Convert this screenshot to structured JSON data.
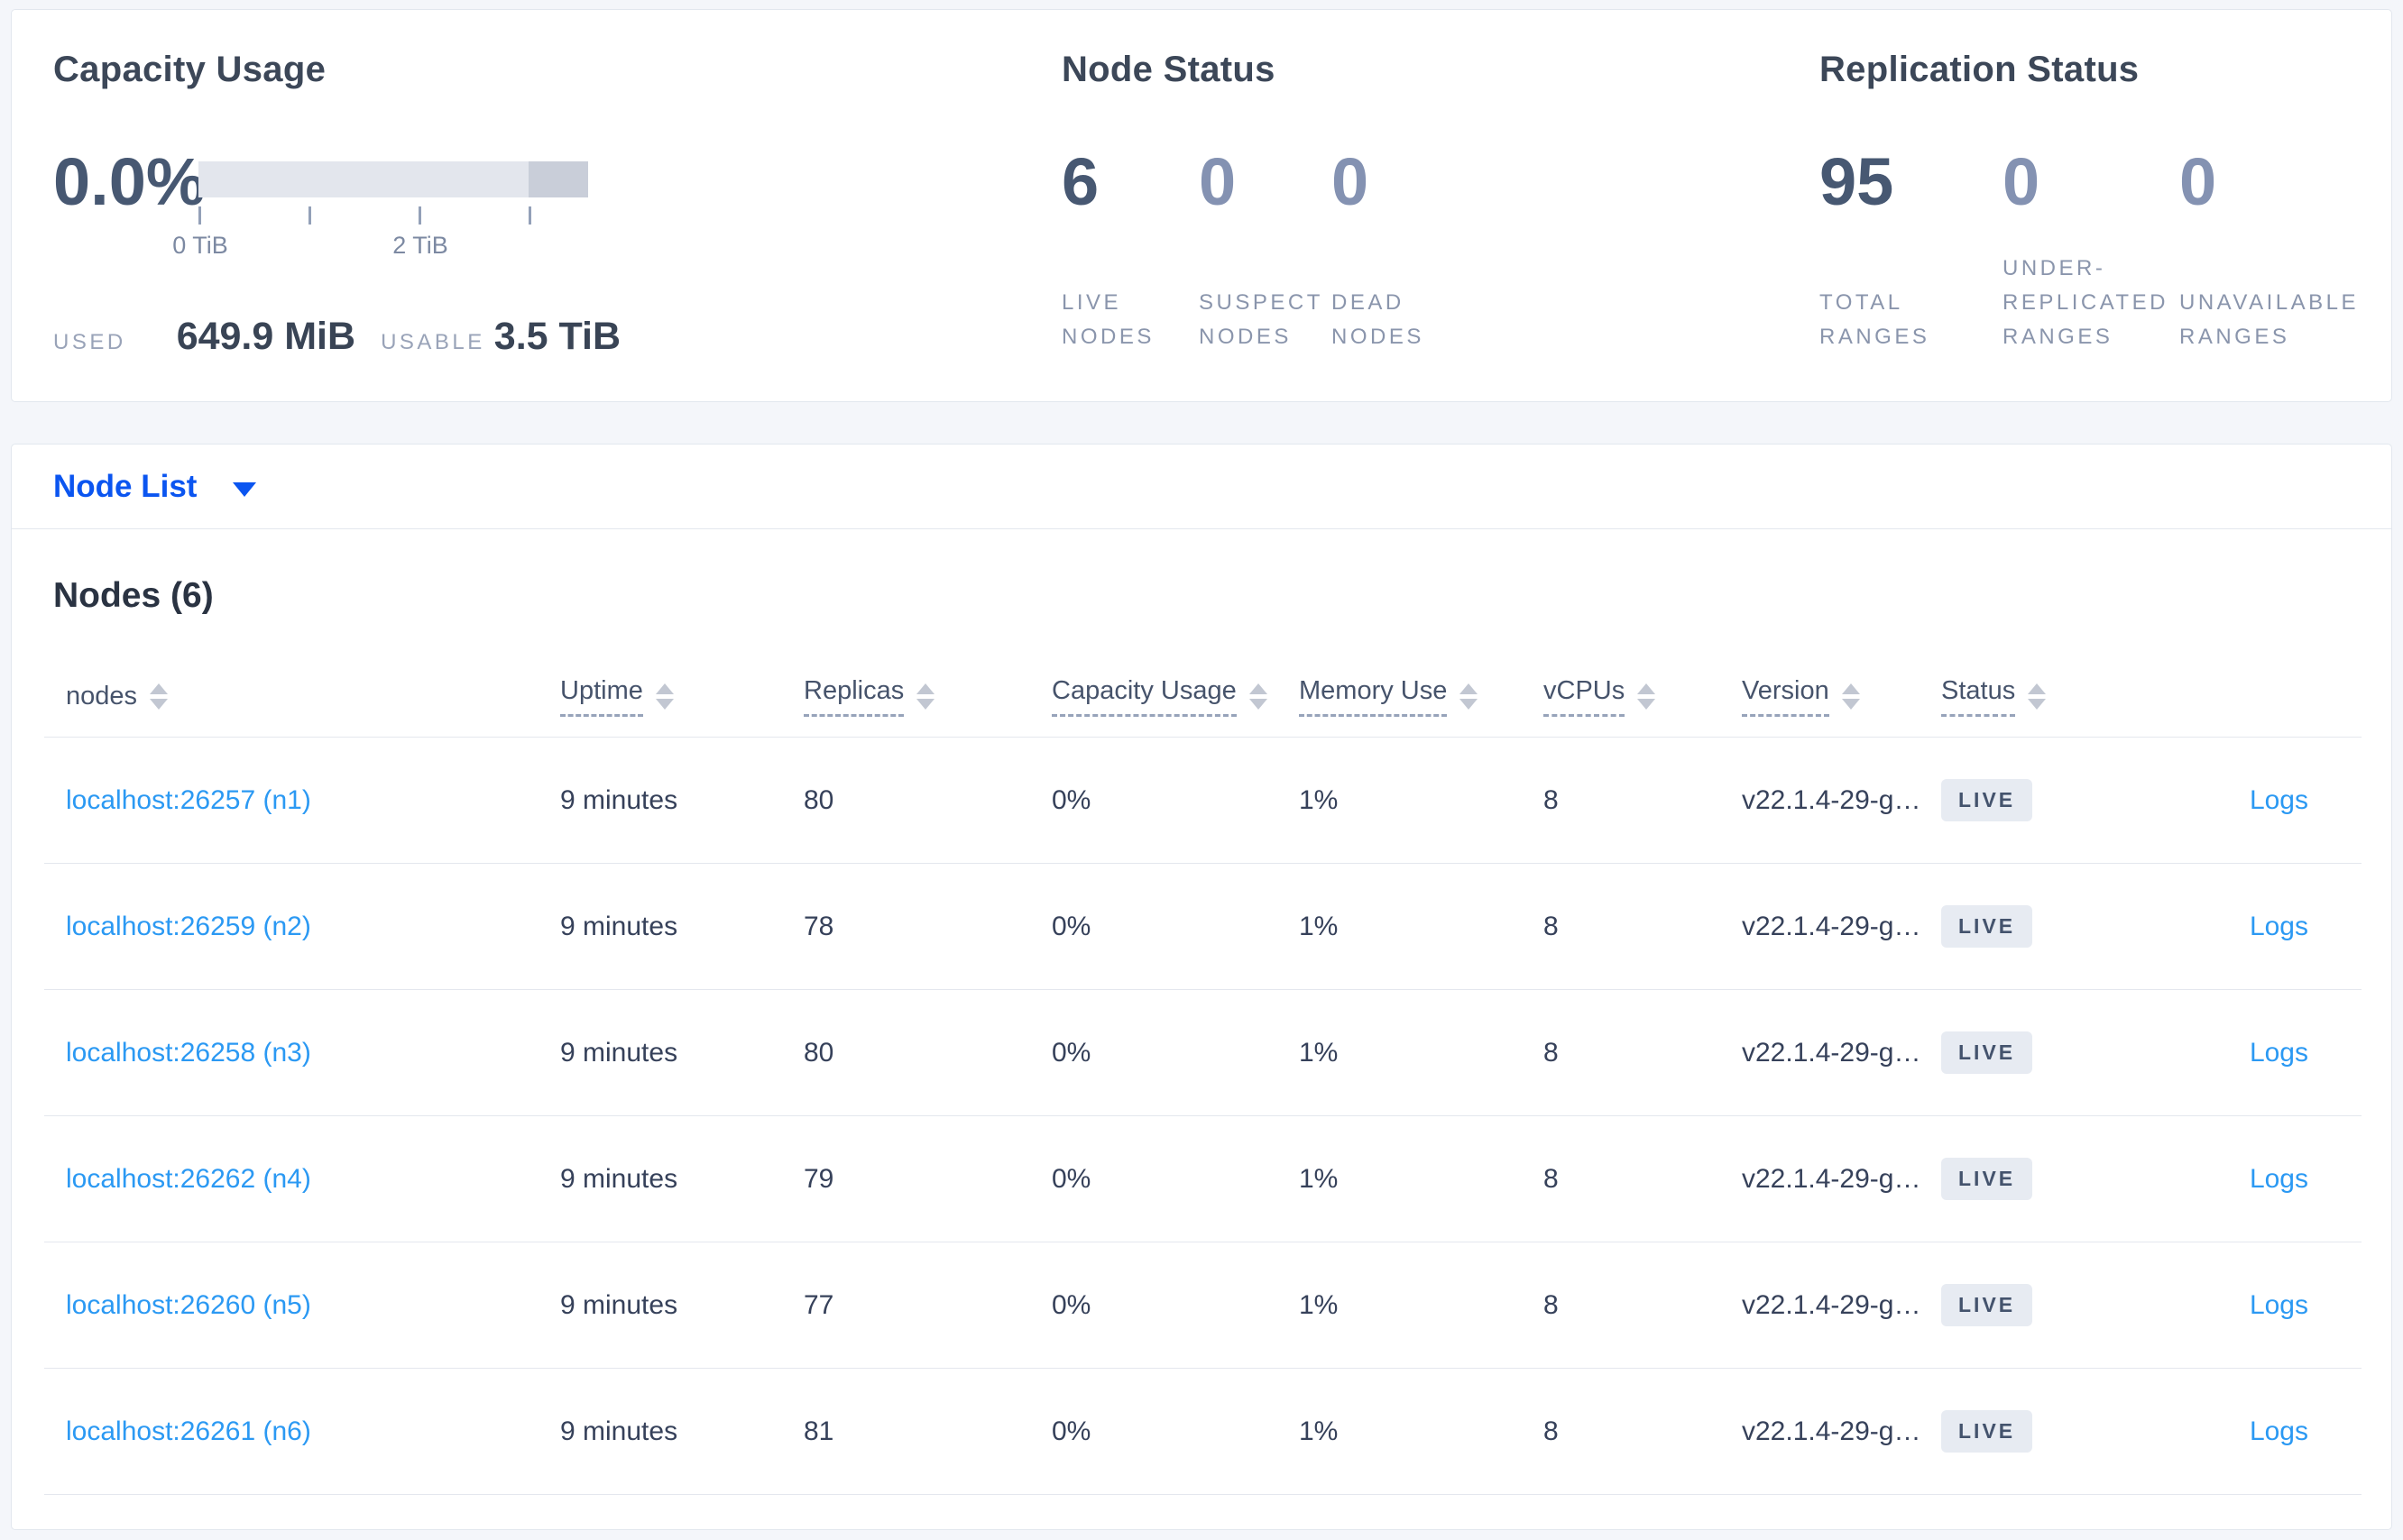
{
  "summary": {
    "capacity": {
      "title": "Capacity Usage",
      "percent": "0.0%",
      "tick_labels": [
        "0 TiB",
        "2 TiB"
      ],
      "used_label": "USED",
      "used_value": "649.9 MiB",
      "usable_label": "USABLE",
      "usable_value": "3.5 TiB"
    },
    "node_status": {
      "title": "Node Status",
      "stats": [
        {
          "value": "6",
          "label": "LIVE\nNODES",
          "muted": false
        },
        {
          "value": "0",
          "label": "SUSPECT\nNODES",
          "muted": true
        },
        {
          "value": "0",
          "label": "DEAD\nNODES",
          "muted": true
        }
      ]
    },
    "replication": {
      "title": "Replication Status",
      "stats": [
        {
          "value": "95",
          "label": "TOTAL\nRANGES",
          "muted": false
        },
        {
          "value": "0",
          "label": "UNDER-\nREPLICATED\nRANGES",
          "muted": true
        },
        {
          "value": "0",
          "label": "UNAVAILABLE\nRANGES",
          "muted": true
        }
      ]
    }
  },
  "view_selector": {
    "label": "Node List",
    "caret_icon": "chevron-down-icon"
  },
  "table": {
    "heading": "Nodes (6)",
    "columns": [
      {
        "key": "nodes",
        "label": "nodes",
        "underline": false,
        "sort_icon": "sort-icon"
      },
      {
        "key": "uptime",
        "label": "Uptime",
        "underline": true,
        "sort_icon": "sort-icon"
      },
      {
        "key": "replicas",
        "label": "Replicas",
        "underline": true,
        "sort_icon": "sort-icon"
      },
      {
        "key": "capacity",
        "label": "Capacity Usage",
        "underline": true,
        "sort_icon": "sort-icon"
      },
      {
        "key": "memory",
        "label": "Memory Use",
        "underline": true,
        "sort_icon": "sort-icon"
      },
      {
        "key": "vcpus",
        "label": "vCPUs",
        "underline": true,
        "sort_icon": "sort-icon"
      },
      {
        "key": "version",
        "label": "Version",
        "underline": true,
        "sort_icon": "sort-icon"
      },
      {
        "key": "status",
        "label": "Status",
        "underline": true,
        "sort_icon": "sort-icon"
      },
      {
        "key": "logs",
        "label": ""
      }
    ],
    "rows": [
      {
        "address": "localhost:26257 (n1)",
        "uptime": "9 minutes",
        "replicas": "80",
        "capacity": "0%",
        "memory": "1%",
        "vcpus": "8",
        "version": "v22.1.4-29-g…",
        "status": "LIVE",
        "logs": "Logs"
      },
      {
        "address": "localhost:26259 (n2)",
        "uptime": "9 minutes",
        "replicas": "78",
        "capacity": "0%",
        "memory": "1%",
        "vcpus": "8",
        "version": "v22.1.4-29-g…",
        "status": "LIVE",
        "logs": "Logs"
      },
      {
        "address": "localhost:26258 (n3)",
        "uptime": "9 minutes",
        "replicas": "80",
        "capacity": "0%",
        "memory": "1%",
        "vcpus": "8",
        "version": "v22.1.4-29-g…",
        "status": "LIVE",
        "logs": "Logs"
      },
      {
        "address": "localhost:26262 (n4)",
        "uptime": "9 minutes",
        "replicas": "79",
        "capacity": "0%",
        "memory": "1%",
        "vcpus": "8",
        "version": "v22.1.4-29-g…",
        "status": "LIVE",
        "logs": "Logs"
      },
      {
        "address": "localhost:26260 (n5)",
        "uptime": "9 minutes",
        "replicas": "77",
        "capacity": "0%",
        "memory": "1%",
        "vcpus": "8",
        "version": "v22.1.4-29-g…",
        "status": "LIVE",
        "logs": "Logs"
      },
      {
        "address": "localhost:26261 (n6)",
        "uptime": "9 minutes",
        "replicas": "81",
        "capacity": "0%",
        "memory": "1%",
        "vcpus": "8",
        "version": "v22.1.4-29-g…",
        "status": "LIVE",
        "logs": "Logs"
      }
    ]
  },
  "colors": {
    "selector_blue": "#0b55f0",
    "link_azure": "#2b99f3",
    "badge_bg": "#e7ebf2",
    "badge_text": "#44536d",
    "bar_light": "#e3e6ed",
    "bar_dark": "#c9ced9"
  }
}
